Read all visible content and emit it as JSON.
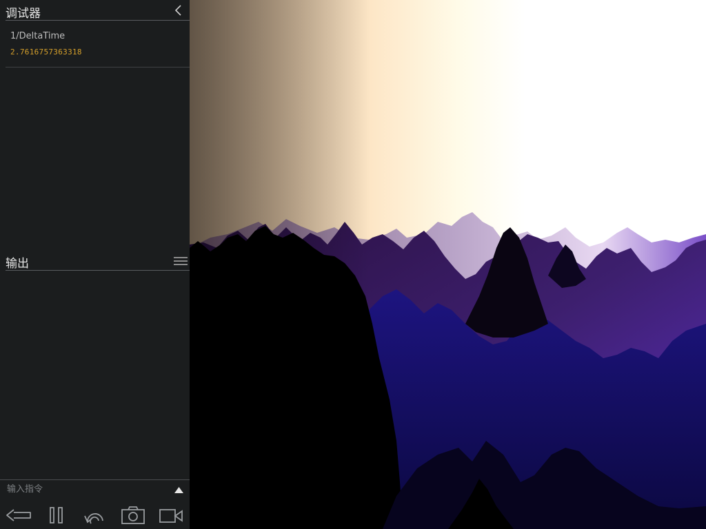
{
  "debugger": {
    "title": "调试器",
    "collapse_icon": "chevron-left-icon",
    "watches": [
      {
        "name": "1/DeltaTime",
        "value": "2.7616757363318"
      }
    ]
  },
  "output": {
    "title": "输出",
    "menu_icon": "hamburger-menu-icon"
  },
  "command": {
    "placeholder": "输入指令",
    "expand_icon": "triangle-up-icon"
  },
  "toolbar": {
    "buttons": [
      {
        "name": "back-button",
        "icon": "arrow-left-icon"
      },
      {
        "name": "pause-button",
        "icon": "pause-icon"
      },
      {
        "name": "restart-button",
        "icon": "restart-icon"
      },
      {
        "name": "screenshot-button",
        "icon": "camera-icon"
      },
      {
        "name": "record-button",
        "icon": "video-camera-icon"
      }
    ]
  },
  "colors": {
    "sidebar_bg": "#1b1d1e",
    "watch_value": "#d7a12b",
    "sky_left": "#b29a80",
    "sky_mid": "#fde6c6",
    "sky_right": "#ffffff",
    "mountain_far": "#c9b4d6",
    "mountain_mid": "#5b2ea8",
    "mountain_near": "#14106a",
    "mountain_dark": "#000000"
  }
}
